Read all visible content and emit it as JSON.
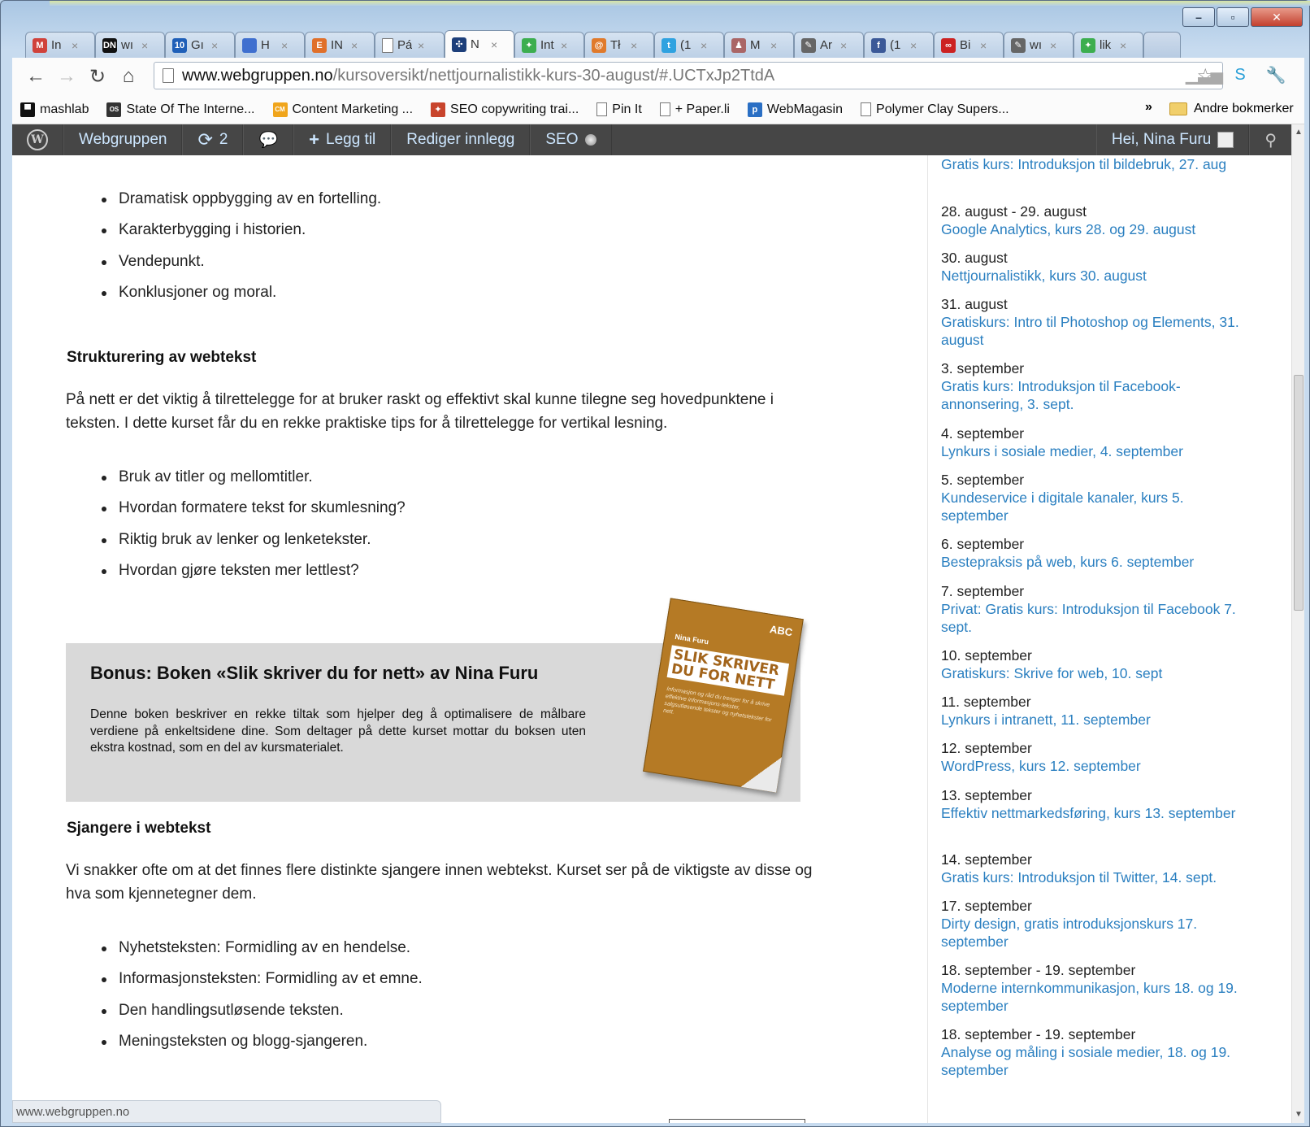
{
  "tabs": [
    {
      "label": "In",
      "icon": "gmail-icon",
      "color": "#d0423b",
      "glyph": "M"
    },
    {
      "label": "wı",
      "icon": "dn-icon",
      "color": "#111111",
      "glyph": "DN"
    },
    {
      "label": "Gı",
      "icon": "number-10-icon",
      "color": "#1f5fb8",
      "glyph": "10"
    },
    {
      "label": "H",
      "icon": "doc-blue-icon",
      "color": "#3f6fcf",
      "glyph": ""
    },
    {
      "label": "IN",
      "icon": "letter-e-icon",
      "color": "#e0702a",
      "glyph": "E"
    },
    {
      "label": "Pá",
      "icon": "blank-page-icon",
      "color": "#ffffff",
      "glyph": ""
    },
    {
      "label": "N",
      "icon": "webgruppen-icon",
      "color": "#1d3f7a",
      "glyph": "✣"
    },
    {
      "label": "Int",
      "icon": "google-puzzle-icon",
      "color": "#3cae4f",
      "glyph": "✦"
    },
    {
      "label": "Tł",
      "icon": "swirl-icon",
      "color": "#e07a2b",
      "glyph": "@"
    },
    {
      "label": "(1",
      "icon": "twitter-icon",
      "color": "#2fa2e0",
      "glyph": "t"
    },
    {
      "label": "M",
      "icon": "person-icon",
      "color": "#a66",
      "glyph": "♟"
    },
    {
      "label": "Ar",
      "icon": "pin-icon",
      "color": "#666666",
      "glyph": "✎"
    },
    {
      "label": "(1",
      "icon": "facebook-icon",
      "color": "#3b5998",
      "glyph": "f"
    },
    {
      "label": "Bi",
      "icon": "chain-link-icon",
      "color": "#cc2222",
      "glyph": "∞"
    },
    {
      "label": "wı",
      "icon": "pin-icon",
      "color": "#666666",
      "glyph": "✎"
    },
    {
      "label": "lik",
      "icon": "google-puzzle-icon",
      "color": "#3cae4f",
      "glyph": "✦"
    }
  ],
  "address": {
    "host": "www.webgruppen.no",
    "path": "/kursoversikt/nettjournalistikk-kurs-30-august/#.UCTxJp2TtdA"
  },
  "bookmarks": [
    {
      "label": "mashlab",
      "icon": "mashlab-icon",
      "color": "#111111",
      "glyph": "▀"
    },
    {
      "label": "State Of The Interne...",
      "icon": "os-icon",
      "color": "#333333",
      "glyph": "OS"
    },
    {
      "label": "Content Marketing ...",
      "icon": "cmi-icon",
      "color": "#f0a51c",
      "glyph": "CM"
    },
    {
      "label": "SEO copywriting trai...",
      "icon": "person-hat-icon",
      "color": "#c8442c",
      "glyph": "✦"
    },
    {
      "label": "Pin It",
      "icon": "blank-page-icon",
      "color": "",
      "glyph": ""
    },
    {
      "label": "+ Paper.li",
      "icon": "blank-page-icon",
      "color": "",
      "glyph": ""
    },
    {
      "label": "WebMagasin",
      "icon": "webmagasin-icon",
      "color": "#2a6fc4",
      "glyph": "p"
    },
    {
      "label": "Polymer Clay Supers...",
      "icon": "blank-page-icon",
      "color": "",
      "glyph": ""
    }
  ],
  "bookmarks_more": "»",
  "bookmarks_other": "Andre bokmerker",
  "adminbar": {
    "site": "Webgruppen",
    "updates": "2",
    "add_new": "Legg til",
    "edit": "Rediger innlegg",
    "seo": "SEO",
    "greeting": "Hei, Nina Furu"
  },
  "content": {
    "list1": [
      "Dramatisk oppbygging av en fortelling.",
      "Karakterbygging i historien.",
      "Vendepunkt.",
      "Konklusjoner og moral."
    ],
    "heading1": "Strukturering av webtekst",
    "para1": "På nett er det viktig å tilrettelegge for at bruker raskt og effektivt skal kunne tilegne seg hovedpunktene i teksten. I dette kurset får du en rekke praktiske tips for å tilrettelegge for vertikal lesning.",
    "list2": [
      "Bruk av titler og mellomtitler.",
      "Hvordan formatere tekst for skumlesning?",
      "Riktig bruk av lenker og lenketekster.",
      "Hvordan gjøre teksten mer lettlest?"
    ],
    "bonus_title": "Bonus: Boken «Slik skriver du for nett» av Nina Furu",
    "bonus_text": "Denne boken beskriver en rekke tiltak som hjelper deg å optimalisere de målbare verdiene på enkeltsidene dine. Som deltager på dette kurset mottar du boksen uten ekstra kostnad, som en del av kursmaterialet.",
    "book": {
      "abc": "ABC",
      "author": "Nina Furu",
      "title": "SLIK SKRIVER DU FOR NETT",
      "subtitle": "Informasjon og råd du trenger for å skrive effektive informasjons-tekster, salgsutløsende tekster og nyhetstekster for nett."
    },
    "heading2": "Sjangere i webtekst",
    "para2": "Vi snakker ofte om at det finnes flere distinkte sjangere innen webtekst. Kurset ser på de viktigste av disse og hva som kjennetegner dem.",
    "list3": [
      "Nyhetsteksten: Formidling av en hendelse.",
      "Informasjonsteksten: Formidling av et emne.",
      "Den handlingsutløsende teksten.",
      "Meningsteksten og blogg-sjangeren."
    ]
  },
  "events": [
    {
      "date": "",
      "title": "Gratis kurs: Introduksjon til bildebruk, 27. aug"
    },
    {
      "date": "28. august - 29. august",
      "title": "Google Analytics, kurs 28. og 29. august"
    },
    {
      "date": "30. august",
      "title": "Nettjournalistikk, kurs 30. august"
    },
    {
      "date": "31. august",
      "title": "Gratiskurs: Intro til Photoshop og Elements, 31. august"
    },
    {
      "date": "3. september",
      "title": "Gratis kurs: Introduksjon til Facebook-annonsering, 3. sept."
    },
    {
      "date": "4. september",
      "title": "Lynkurs i sosiale medier, 4. september"
    },
    {
      "date": "5. september",
      "title": "Kundeservice i digitale kanaler, kurs 5. september"
    },
    {
      "date": "6. september",
      "title": "Bestepraksis på web, kurs 6. september"
    },
    {
      "date": "7. september",
      "title": "Privat: Gratis kurs: Introduksjon til Facebook 7. sept."
    },
    {
      "date": "10. september",
      "title": "Gratiskurs: Skrive for web, 10. sept"
    },
    {
      "date": "11. september",
      "title": "Lynkurs i intranett, 11. september"
    },
    {
      "date": "12. september",
      "title": "WordPress, kurs 12. september"
    },
    {
      "date": "13. september",
      "title": "Effektiv nettmarkedsføring, kurs 13. september"
    },
    {
      "date": "14. september",
      "title": "Gratis kurs: Introduksjon til Twitter, 14. sept."
    },
    {
      "date": "17. september",
      "title": "Dirty design, gratis introduksjonskurs 17. september"
    },
    {
      "date": "18. september - 19. september",
      "title": "Moderne internkommunikasjon, kurs 18. og 19. september"
    },
    {
      "date": "18. september - 19. september",
      "title": "Analyse og måling i sosiale medier, 18. og 19. september"
    }
  ],
  "statusbar": "www.webgruppen.no",
  "window_buttons": {
    "minimize": "–",
    "maximize": "▫",
    "close": "✕"
  }
}
